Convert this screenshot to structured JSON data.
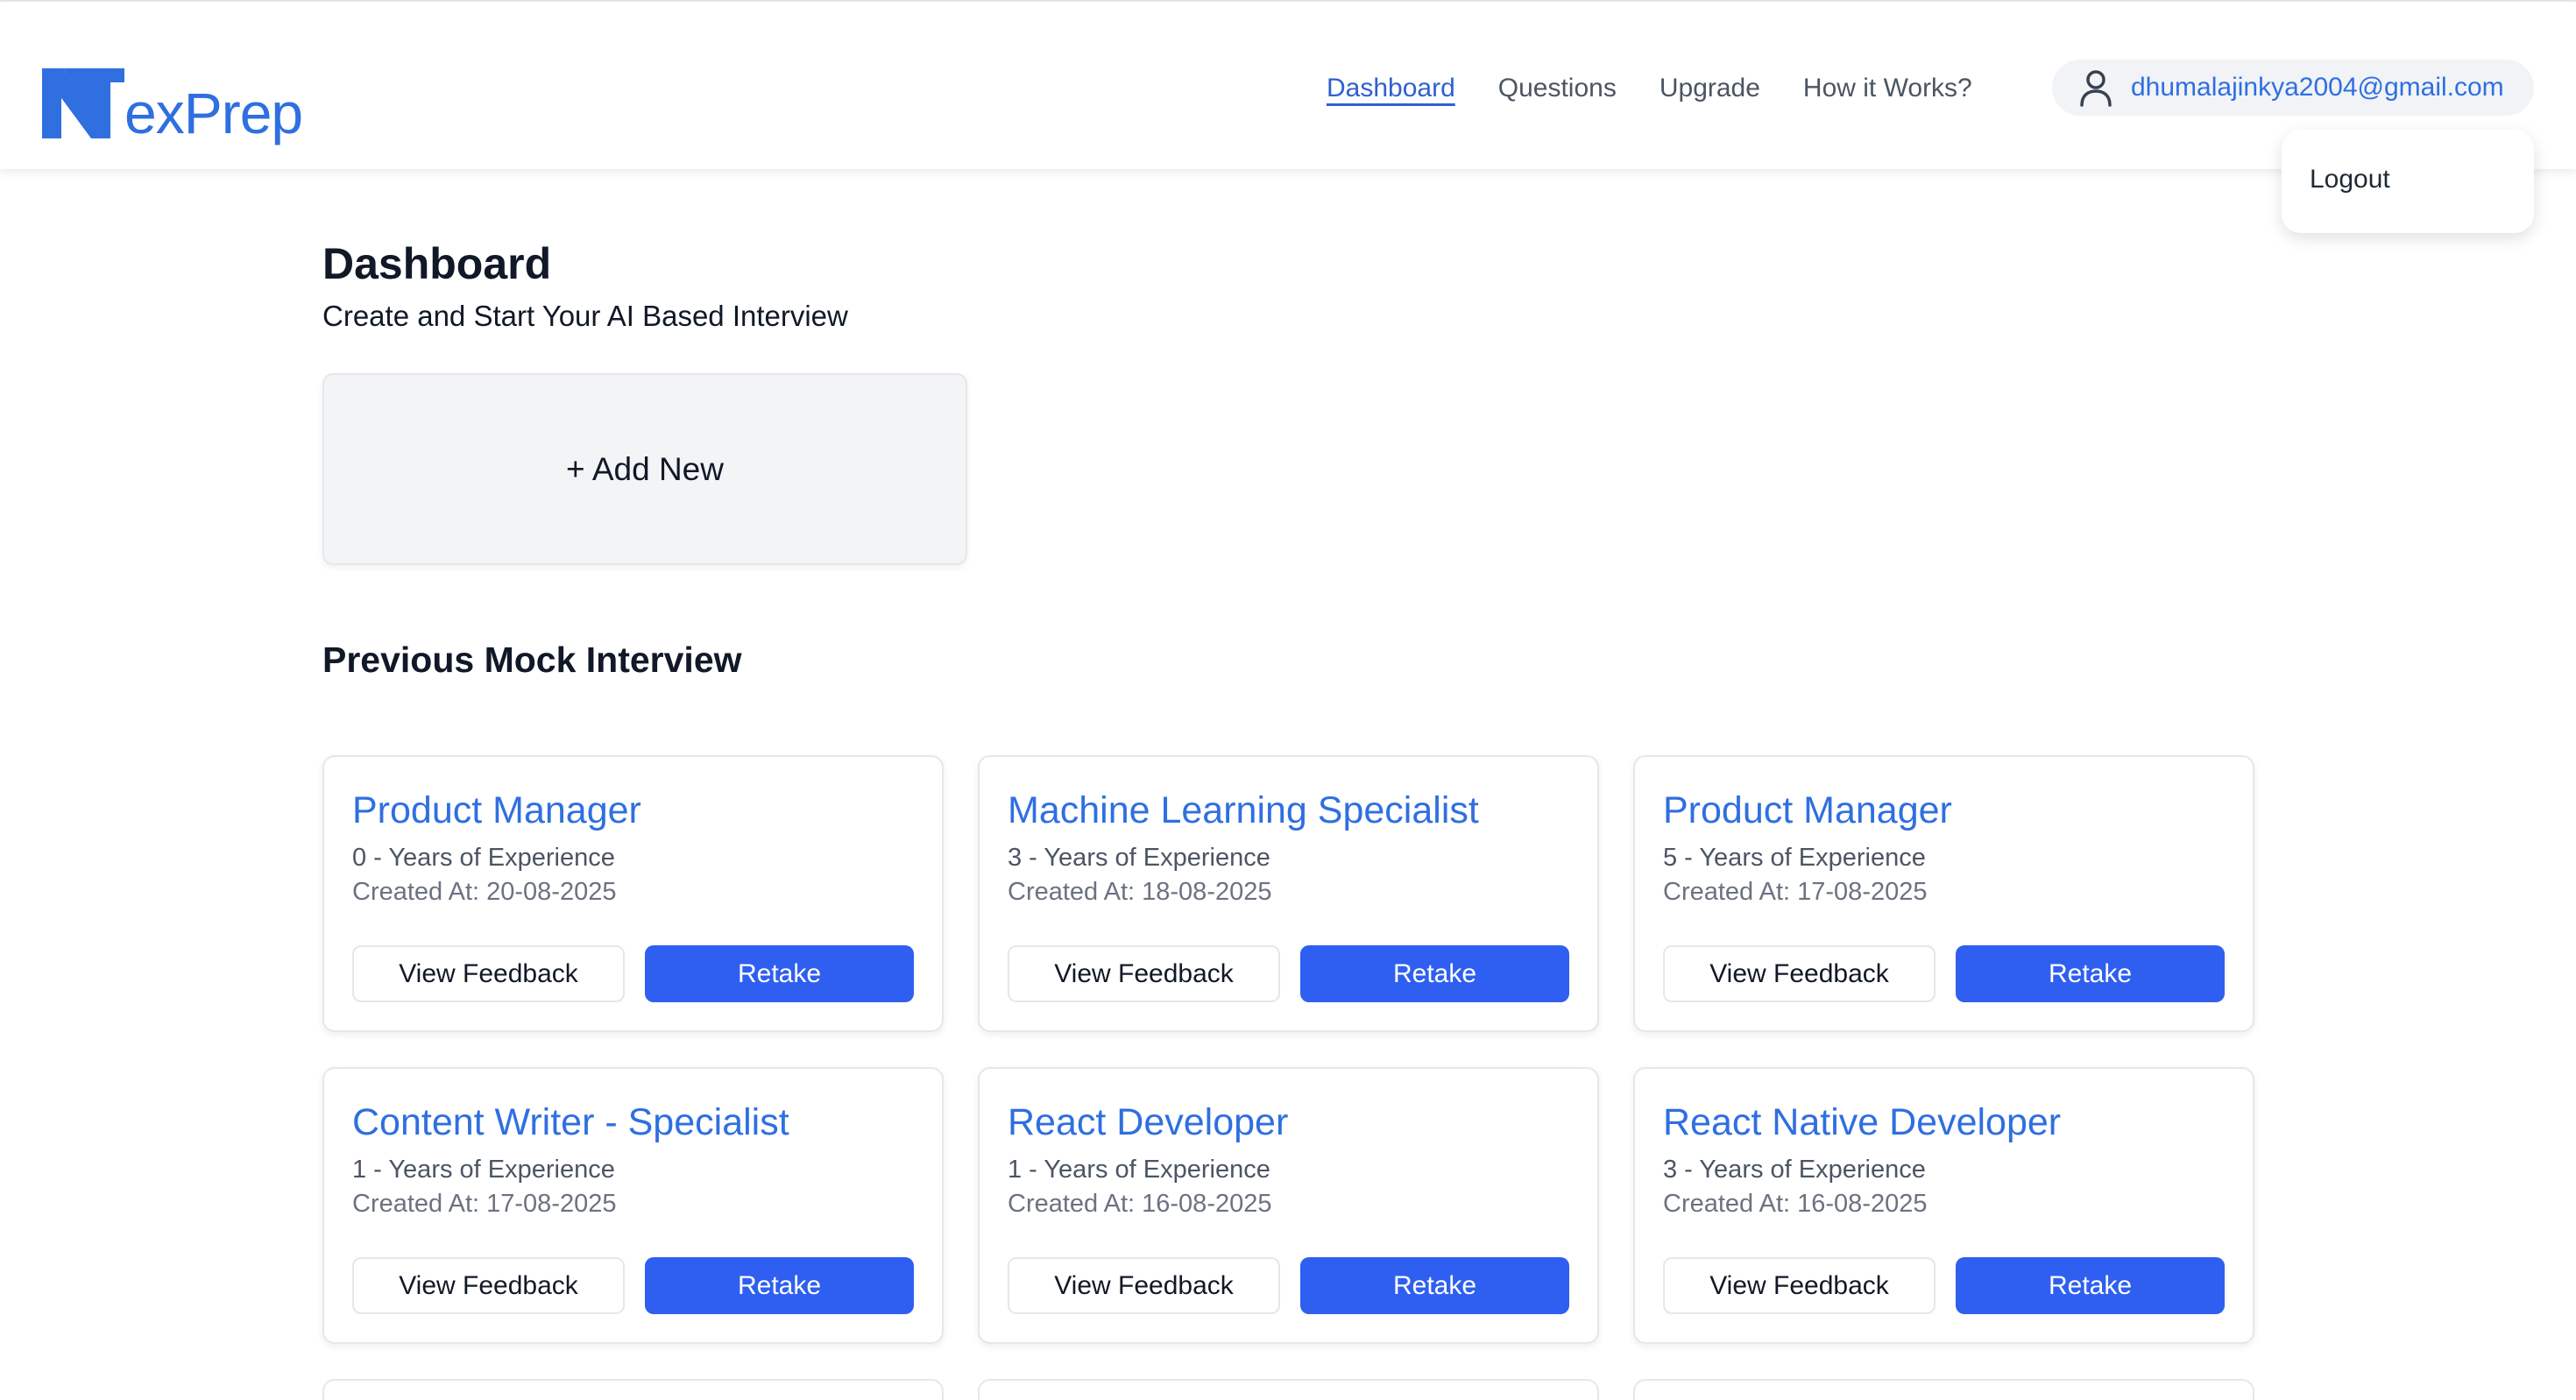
{
  "header": {
    "logo_text": "exPrep",
    "nav": [
      {
        "label": "Dashboard",
        "active": true
      },
      {
        "label": "Questions",
        "active": false
      },
      {
        "label": "Upgrade",
        "active": false
      },
      {
        "label": "How it Works?",
        "active": false
      }
    ],
    "user_email": "dhumalajinkya2004@gmail.com",
    "user_icon": "user-icon",
    "dropdown": {
      "logout_label": "Logout"
    }
  },
  "main": {
    "title": "Dashboard",
    "subtitle": "Create and Start Your AI Based Interview",
    "add_new_label": "+ Add New",
    "section_title": "Previous Mock Interview",
    "interviews": [
      {
        "title": "Product Manager",
        "experience": "0 - Years of Experience",
        "created": "Created At: 20-08-2025",
        "view_label": "View Feedback",
        "retake_label": "Retake"
      },
      {
        "title": "Machine Learning Specialist",
        "experience": "3 - Years of Experience",
        "created": "Created At: 18-08-2025",
        "view_label": "View Feedback",
        "retake_label": "Retake"
      },
      {
        "title": "Product Manager",
        "experience": "5 - Years of Experience",
        "created": "Created At: 17-08-2025",
        "view_label": "View Feedback",
        "retake_label": "Retake"
      },
      {
        "title": "Content Writer - Specialist",
        "experience": "1 - Years of Experience",
        "created": "Created At: 17-08-2025",
        "view_label": "View Feedback",
        "retake_label": "Retake"
      },
      {
        "title": "React Developer",
        "experience": "1 - Years of Experience",
        "created": "Created At: 16-08-2025",
        "view_label": "View Feedback",
        "retake_label": "Retake"
      },
      {
        "title": "React Native Developer",
        "experience": "3 - Years of Experience",
        "created": "Created At: 16-08-2025",
        "view_label": "View Feedback",
        "retake_label": "Retake"
      }
    ]
  },
  "colors": {
    "brand": "#2f6fe0",
    "primary_button": "#2f5ff0",
    "text": "#111827",
    "muted": "#6b7280"
  }
}
